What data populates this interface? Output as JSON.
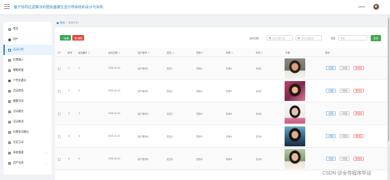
{
  "app": {
    "title": "基于协同过滤算法的居民健康生活引导系统的设计与实现",
    "user_name": "admin"
  },
  "sidebar": {
    "items": [
      {
        "label": "首页",
        "icon": "home-icon"
      },
      {
        "label": "用户",
        "icon": "user-icon"
      },
      {
        "label": "运动计划",
        "icon": "document-icon",
        "active": true
      },
      {
        "label": "饮食摄入",
        "icon": "grid-icon"
      },
      {
        "label": "睡眠质量",
        "icon": "grid-icon"
      },
      {
        "label": "个性化建议",
        "icon": "tag-icon"
      },
      {
        "label": "活动类别",
        "icon": "grid-icon"
      },
      {
        "label": "健康活动",
        "icon": "grid-icon"
      },
      {
        "label": "活动报名",
        "icon": "grid-icon"
      },
      {
        "label": "活动取消",
        "icon": "grid-icon"
      },
      {
        "label": "饮食知识建议",
        "icon": "grid-icon"
      },
      {
        "label": "社区互动",
        "icon": "grid-icon"
      },
      {
        "label": "系统管理",
        "icon": "grid-icon",
        "chevron": true
      },
      {
        "label": "用户信息",
        "icon": "grid-icon",
        "chevron": true
      }
    ]
  },
  "breadcrumb": {
    "home": "首页",
    "current": "运动计划"
  },
  "toolbar": {
    "add_label": "+ 新增",
    "delete_label": "🗑 删除",
    "date_label": "活动日期",
    "date_start_placeholder": "活动日期开始",
    "date_end_placeholder": "活动日期结束",
    "type_label": "类型",
    "type_placeholder": "类型",
    "search_label": "查询"
  },
  "table": {
    "columns": [
      "序号",
      "活动编号",
      "活动日期",
      "用户账号",
      "姓名",
      "性别",
      "年龄",
      "手机",
      "头像",
      "操作"
    ],
    "rows": [
      {
        "index": "1",
        "code": "1",
        "date": "2024-04-20",
        "account": "用户账号1",
        "name": "姓名1",
        "gender": "性别1",
        "age": "年龄1",
        "phone": "手机1"
      },
      {
        "index": "2",
        "code": "2",
        "date": "2024-04-20",
        "account": "用户账号2",
        "name": "姓名2",
        "gender": "性别2",
        "age": "年龄2",
        "phone": "手机2"
      },
      {
        "index": "3",
        "code": "3",
        "date": "2024-04-20",
        "account": "用户账号3",
        "name": "姓名3",
        "gender": "性别3",
        "age": "年龄3",
        "phone": "手机3"
      },
      {
        "index": "4",
        "code": "4",
        "date": "2024-04-20",
        "account": "用户账号4",
        "name": "姓名4",
        "gender": "性别4",
        "age": "年龄4",
        "phone": "手机4"
      },
      {
        "index": "5",
        "code": "5",
        "date": "2024-04-20",
        "account": "用户账号5",
        "name": "姓名5",
        "gender": "性别5",
        "age": "年龄5",
        "phone": "手机5"
      }
    ],
    "actions": {
      "view": "查看",
      "edit": "修改",
      "delete": "删除"
    }
  },
  "watermark": "CSDN @全传程序毕设",
  "colors": {
    "accent": "#2c7fb8",
    "add": "#3aa757",
    "danger": "#e9453f",
    "search": "#46a74c"
  }
}
